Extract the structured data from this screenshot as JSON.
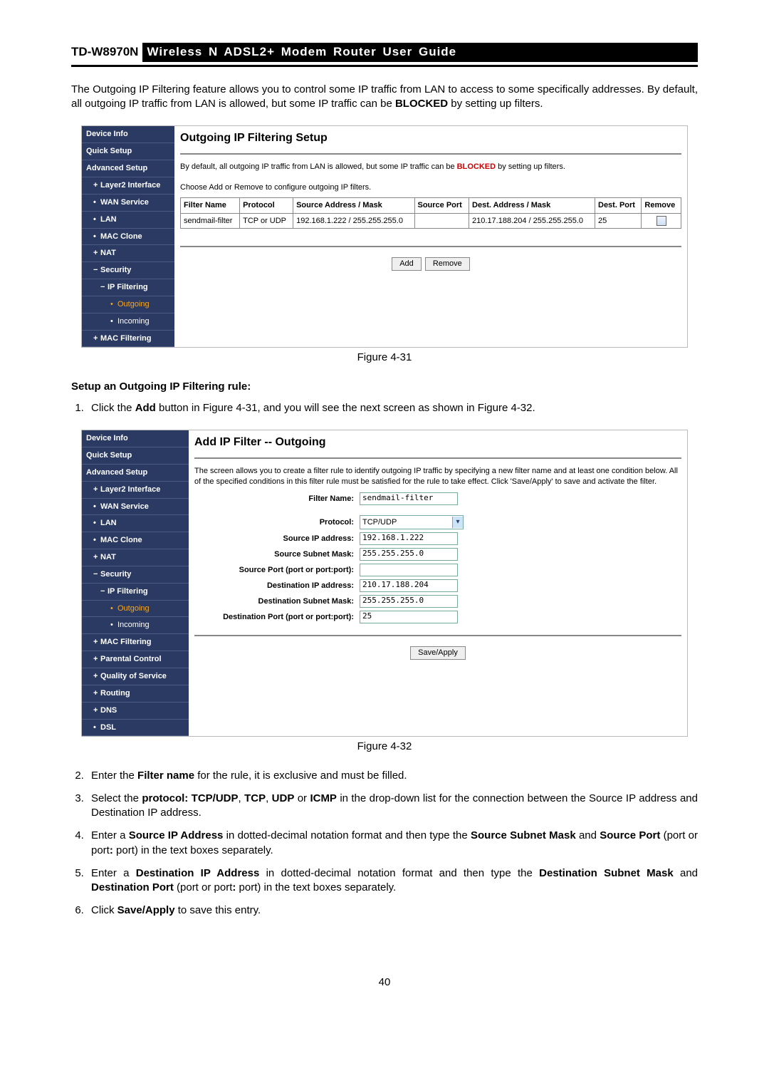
{
  "header": {
    "model": "TD-W8970N",
    "title": "Wireless N ADSL2+ Modem Router User Guide"
  },
  "intro_a": "The Outgoing IP Filtering feature allows you to control some IP traffic from LAN to access to some specifically addresses. By default, all outgoing IP traffic from LAN is allowed, but some IP traffic can be ",
  "intro_blocked": "BLOCKED",
  "intro_b": " by setting up filters.",
  "fig1": {
    "caption": "Figure 4-31",
    "sidebar": {
      "device_info": "Device Info",
      "quick_setup": "Quick Setup",
      "advanced_setup": "Advanced Setup",
      "layer2": "Layer2 Interface",
      "wan": "WAN Service",
      "lan": "LAN",
      "mac_clone": "MAC Clone",
      "nat": "NAT",
      "security": "Security",
      "ip_filtering": "IP Filtering",
      "outgoing": "Outgoing",
      "incoming": "Incoming",
      "mac_filtering": "MAC Filtering"
    },
    "panel": {
      "title": "Outgoing IP Filtering Setup",
      "note_a": "By default, all outgoing IP traffic from LAN is allowed, but some IP traffic can be ",
      "note_blocked": "BLOCKED",
      "note_b": " by setting up filters.",
      "note2": "Choose Add or Remove to configure outgoing IP filters.",
      "headers": {
        "filter_name": "Filter Name",
        "protocol": "Protocol",
        "src": "Source Address / Mask",
        "src_port": "Source Port",
        "dst": "Dest. Address / Mask",
        "dst_port": "Dest. Port",
        "remove": "Remove"
      },
      "row": {
        "filter_name": "sendmail-filter",
        "protocol": "TCP or UDP",
        "src": "192.168.1.222 / 255.255.255.0",
        "src_port": "",
        "dst": "210.17.188.204 / 255.255.255.0",
        "dst_port": "25"
      },
      "btn_add": "Add",
      "btn_remove": "Remove"
    }
  },
  "setup_heading": "Setup an Outgoing IP Filtering rule:",
  "step1_a": "Click the ",
  "step1_b": "Add",
  "step1_c": " button in Figure 4-31, and you will see the next screen as shown in Figure 4-32.",
  "fig2": {
    "caption": "Figure 4-32",
    "sidebar": {
      "device_info": "Device Info",
      "quick_setup": "Quick Setup",
      "advanced_setup": "Advanced Setup",
      "layer2": "Layer2 Interface",
      "wan": "WAN Service",
      "lan": "LAN",
      "mac_clone": "MAC Clone",
      "nat": "NAT",
      "security": "Security",
      "ip_filtering": "IP Filtering",
      "outgoing": "Outgoing",
      "incoming": "Incoming",
      "mac_filtering": "MAC Filtering",
      "parental": "Parental Control",
      "qos": "Quality of Service",
      "routing": "Routing",
      "dns": "DNS",
      "dsl": "DSL"
    },
    "panel": {
      "title": "Add IP Filter -- Outgoing",
      "desc": "The screen allows you to create a filter rule to identify outgoing IP traffic by specifying a new filter name and at least one condition below. All of the specified conditions in this filter rule must be satisfied for the rule to take effect. Click 'Save/Apply' to save and activate the filter.",
      "labels": {
        "filter_name": "Filter Name:",
        "protocol": "Protocol:",
        "src_ip": "Source IP address:",
        "src_mask": "Source Subnet Mask:",
        "src_port": "Source Port (port or port:port):",
        "dst_ip": "Destination IP address:",
        "dst_mask": "Destination Subnet Mask:",
        "dst_port": "Destination Port (port or port:port):"
      },
      "values": {
        "filter_name": "sendmail-filter",
        "protocol": "TCP/UDP",
        "src_ip": "192.168.1.222",
        "src_mask": "255.255.255.0",
        "src_port": "",
        "dst_ip": "210.17.188.204",
        "dst_mask": "255.255.255.0",
        "dst_port": "25"
      },
      "btn_save": "Save/Apply"
    }
  },
  "step2_a": "Enter the ",
  "step2_b": "Filter name",
  "step2_c": " for the rule, it is exclusive and must be filled.",
  "step3_a": "Select the ",
  "step3_b": "protocol: TCP/UDP",
  "step3_c": ", ",
  "step3_d": "TCP",
  "step3_e": ", ",
  "step3_f": "UDP",
  "step3_g": " or ",
  "step3_h": "ICMP",
  "step3_i": " in the drop-down list for the connection between the Source IP address and Destination IP address.",
  "step4_a": "Enter a ",
  "step4_b": "Source IP Address",
  "step4_c": " in dotted-decimal notation format and then type the ",
  "step4_d": "Source Subnet Mask",
  "step4_e": " and ",
  "step4_f": "Source Port",
  "step4_g": " (port or port",
  "step4_h": ":",
  "step4_i": " port) in the text boxes separately.",
  "step5_a": "Enter a ",
  "step5_b": "Destination IP Address",
  "step5_c": " in dotted-decimal notation format and then type the ",
  "step5_d": "Destination Subnet Mask",
  "step5_e": " and ",
  "step5_f": "Destination Port",
  "step5_g": " (port or port",
  "step5_h": ":",
  "step5_i": " port) in the text boxes separately.",
  "step6_a": "Click ",
  "step6_b": "Save/Apply",
  "step6_c": " to save this entry.",
  "page_number": "40"
}
